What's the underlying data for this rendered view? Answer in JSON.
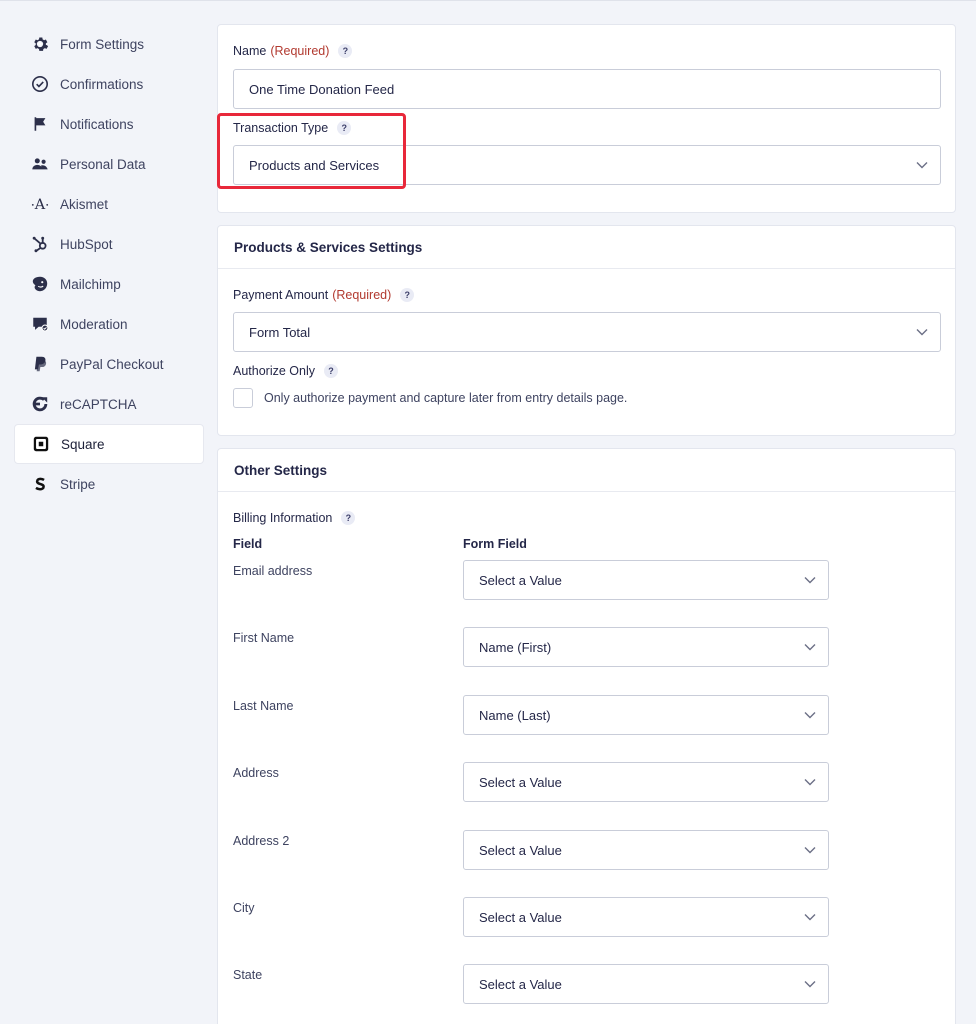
{
  "sidebar": {
    "items": [
      {
        "label": "Form Settings",
        "icon": "gear-icon"
      },
      {
        "label": "Confirmations",
        "icon": "check-circle-icon"
      },
      {
        "label": "Notifications",
        "icon": "flag-icon"
      },
      {
        "label": "Personal Data",
        "icon": "people-icon"
      },
      {
        "label": "Akismet",
        "icon": "akismet-icon"
      },
      {
        "label": "HubSpot",
        "icon": "hubspot-icon"
      },
      {
        "label": "Mailchimp",
        "icon": "mailchimp-icon"
      },
      {
        "label": "Moderation",
        "icon": "moderation-icon"
      },
      {
        "label": "PayPal Checkout",
        "icon": "paypal-icon"
      },
      {
        "label": "reCAPTCHA",
        "icon": "recaptcha-icon"
      },
      {
        "label": "Square",
        "icon": "square-icon",
        "active": true
      },
      {
        "label": "Stripe",
        "icon": "stripe-icon"
      }
    ]
  },
  "feed": {
    "name_label": "Name",
    "required_text": "(Required)",
    "name_value": "One Time Donation Feed",
    "transaction_type_label": "Transaction Type",
    "transaction_type_value": "Products and Services"
  },
  "products": {
    "header": "Products & Services Settings",
    "payment_amount_label": "Payment Amount",
    "required_text": "(Required)",
    "payment_amount_value": "Form Total",
    "authorize_label": "Authorize Only",
    "authorize_checkbox_text": "Only authorize payment and capture later from entry details page."
  },
  "other": {
    "header": "Other Settings",
    "billing_label": "Billing Information",
    "col_field": "Field",
    "col_form_field": "Form Field",
    "rows": [
      {
        "field": "Email address",
        "value": "Select a Value"
      },
      {
        "field": "First Name",
        "value": "Name (First)"
      },
      {
        "field": "Last Name",
        "value": "Name (Last)"
      },
      {
        "field": "Address",
        "value": "Select a Value"
      },
      {
        "field": "Address 2",
        "value": "Select a Value"
      },
      {
        "field": "City",
        "value": "Select a Value"
      },
      {
        "field": "State",
        "value": "Select a Value"
      }
    ]
  },
  "help_glyph": "?",
  "colors": {
    "required": "#b23a30",
    "highlight": "#e8283a",
    "background": "#f2f4f9"
  }
}
